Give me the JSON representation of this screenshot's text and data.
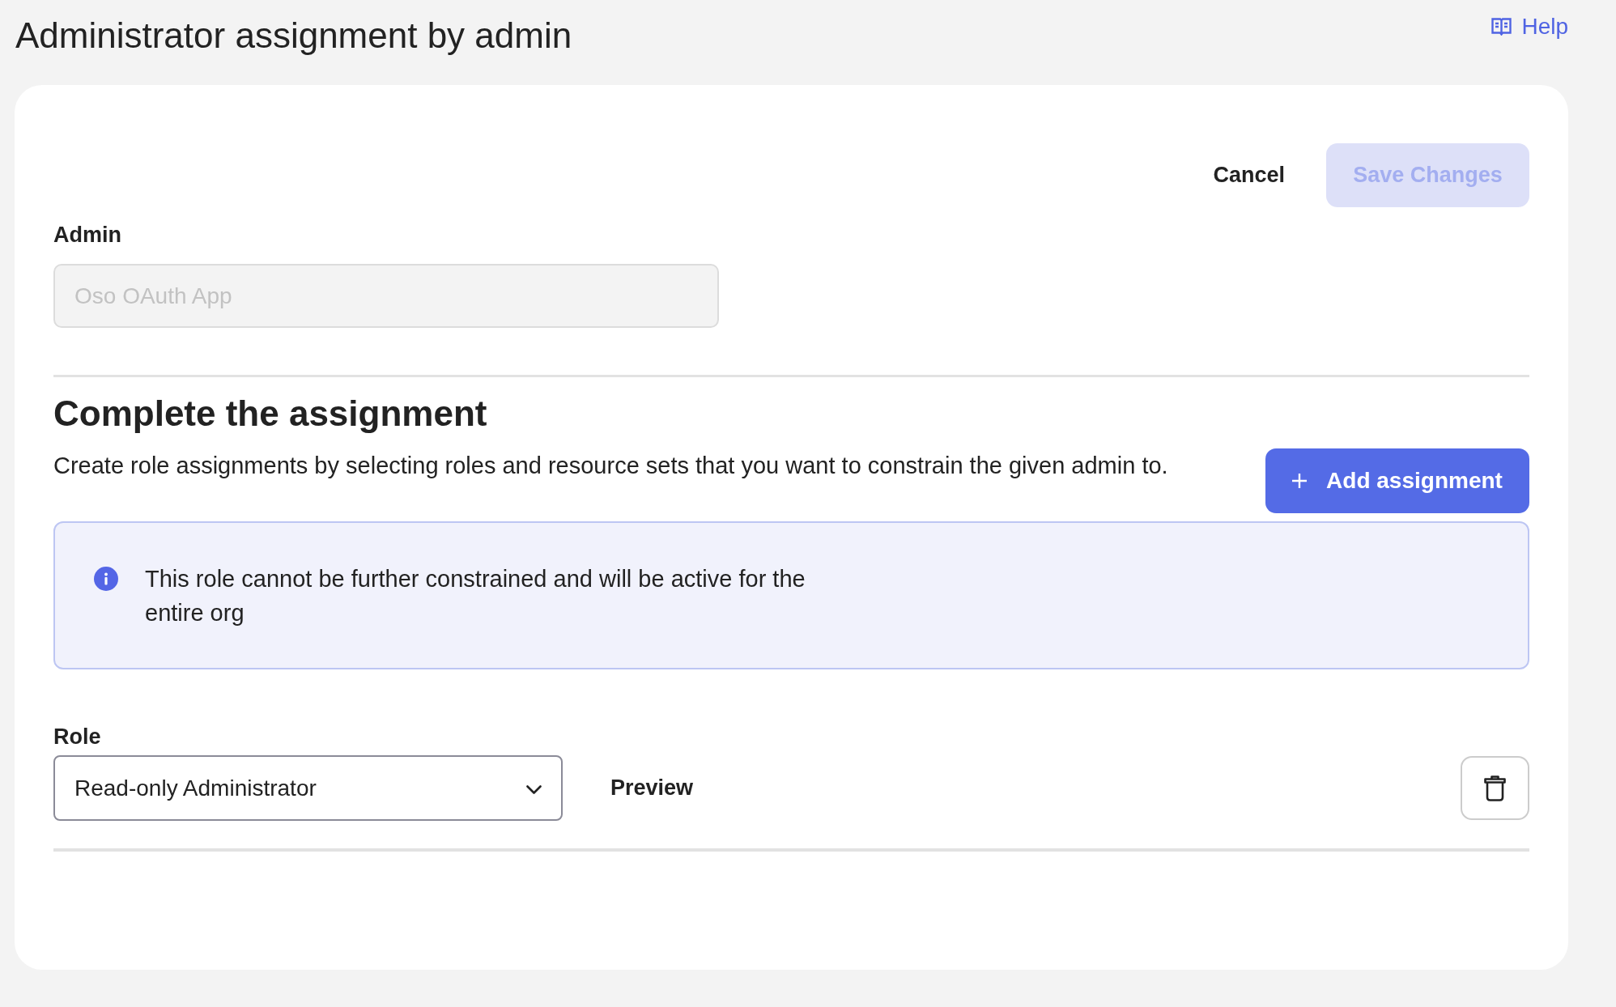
{
  "page": {
    "title": "Administrator assignment by admin",
    "help_link": "Help"
  },
  "actions": {
    "cancel": "Cancel",
    "save": {
      "label": "Save Changes",
      "disabled": true
    }
  },
  "admin_field": {
    "label": "Admin",
    "value": "Oso OAuth App",
    "disabled": true
  },
  "assignment_section": {
    "heading": "Complete the assignment",
    "description": "Create role assignments by selecting roles and resource sets that you want to constrain the given admin to.",
    "add_button": "Add assignment",
    "notice": "This role cannot be further constrained and will be active for the entire org"
  },
  "assignments": [
    {
      "role_label": "Role",
      "role": "Read-only Administrator",
      "preview": "Preview"
    }
  ]
}
